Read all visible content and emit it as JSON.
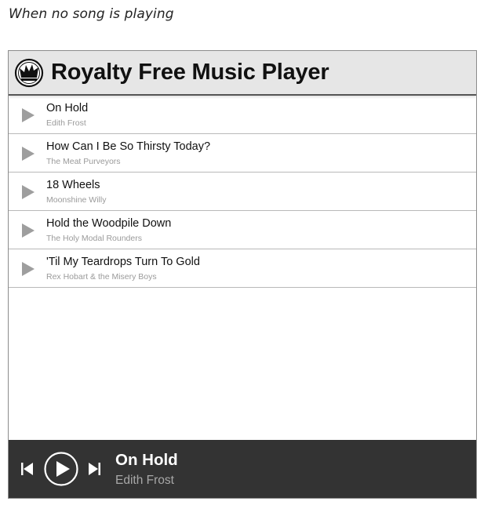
{
  "caption": "When no song is playing",
  "app": {
    "title": "Royalty Free Music Player",
    "logo_icon": "crown-icon"
  },
  "tracks": [
    {
      "title": "On Hold",
      "artist": "Edith Frost"
    },
    {
      "title": "How Can I Be So Thirsty Today?",
      "artist": "The Meat Purveyors"
    },
    {
      "title": "18 Wheels",
      "artist": "Moonshine Willy"
    },
    {
      "title": "Hold the Woodpile Down",
      "artist": "The Holy Modal Rounders"
    },
    {
      "title": "'Til My Teardrops Turn To Gold",
      "artist": "Rex Hobart & the Misery Boys"
    }
  ],
  "now_playing": {
    "title": "On Hold",
    "artist": "Edith Frost",
    "controls": [
      "skip-previous-icon",
      "play-icon",
      "skip-next-icon"
    ]
  },
  "colors": {
    "header_bg": "#e6e6e6",
    "bar_bg": "#333333",
    "track_play_icon": "#9e9e9e"
  }
}
